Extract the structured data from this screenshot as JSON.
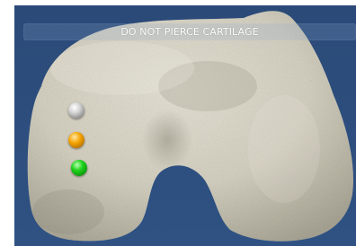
{
  "viewer": {
    "banner_text": "DO NOT PIERCE CARTILAGE",
    "background_color": "#2d4e7a",
    "bone_color": "#d9d6c8"
  },
  "markers": [
    {
      "name": "grey-marker",
      "color": "#b5b5b5"
    },
    {
      "name": "orange-marker",
      "color": "#f0a000"
    },
    {
      "name": "green-marker",
      "color": "#18c818"
    }
  ]
}
